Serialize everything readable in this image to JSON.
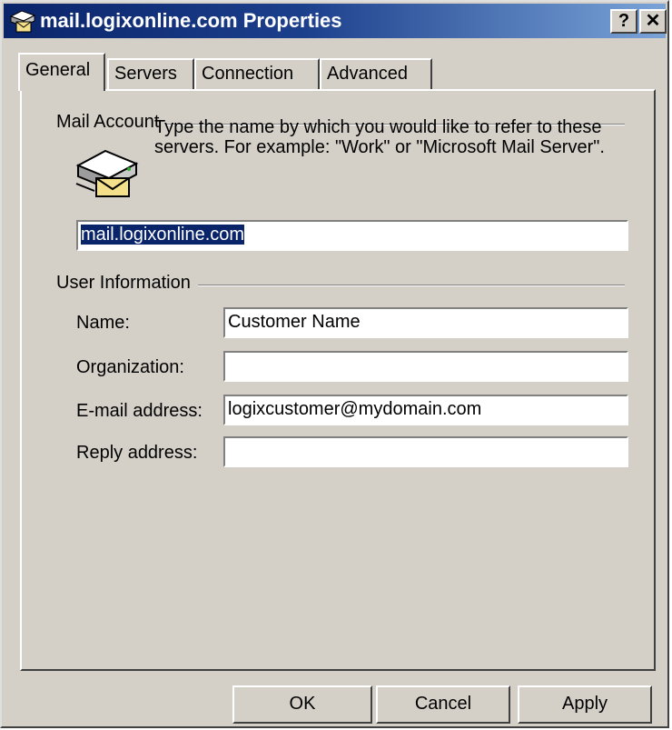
{
  "window": {
    "title": "mail.logixonline.com Properties",
    "help_label": "?",
    "close_label": "✕"
  },
  "tabs": [
    {
      "label": "General",
      "active": true
    },
    {
      "label": "Servers",
      "active": false
    },
    {
      "label": "Connection",
      "active": false
    },
    {
      "label": "Advanced",
      "active": false
    }
  ],
  "mail_account": {
    "heading": "Mail Account",
    "description": "Type the name by which you would like to refer to these servers.  For example: \"Work\" or \"Microsoft Mail Server\".",
    "account_name": "mail.logixonline.com"
  },
  "user_info": {
    "heading": "User Information",
    "name_label": "Name:",
    "name_value": "Customer Name",
    "org_label": "Organization:",
    "org_value": "",
    "email_label": "E-mail address:",
    "email_value": "logixcustomer@mydomain.com",
    "reply_label": "Reply address:",
    "reply_value": ""
  },
  "buttons": {
    "ok": "OK",
    "cancel": "Cancel",
    "apply": "Apply"
  },
  "icons": {
    "title": "mail-server-icon",
    "account": "mail-server-envelope-icon"
  },
  "colors": {
    "titlebar_start": "#0a246a",
    "titlebar_end": "#7aa4d8",
    "face": "#d4d0c8",
    "selection": "#0a246a"
  }
}
